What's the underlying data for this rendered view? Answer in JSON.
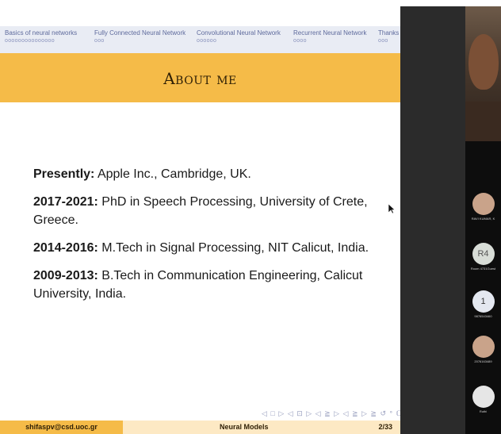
{
  "slide": {
    "nav_sections": [
      {
        "label": "Basics of neural networks",
        "dots": "ooooooooooooooo"
      },
      {
        "label": "Fully Connected Neural Network",
        "dots": "ooo"
      },
      {
        "label": "Convolutional Neural Network",
        "dots": "oooooo"
      },
      {
        "label": "Recurrent Neural Network",
        "dots": "oooo"
      },
      {
        "label": "Thanks",
        "dots": "ooo"
      }
    ],
    "title": "About me",
    "entries": [
      {
        "label": "Presently:",
        "text": " Apple Inc., Cambridge, UK."
      },
      {
        "label": "2017-2021:",
        "text": " PhD in Speech Processing, University of Crete, Greece."
      },
      {
        "label": "2014-2016:",
        "text": " M.Tech in Signal Processing, NIT Calicut, India."
      },
      {
        "label": "2009-2013:",
        "text": " B.Tech in Communication Engineering, Calicut University, India."
      }
    ],
    "nav_symbols": "◁ □ ▷ ◁ ⊡ ▷ ◁ ≧ ▷ ◁ ≧ ▷   ≧   ↺ ᐤ ℂ",
    "footer": {
      "email": "shifaspv@csd.uoc.gr",
      "title": "Neural Models",
      "page": "2/33"
    }
  },
  "participants": [
    {
      "name": "RAVI KUMAR, K",
      "avatar_type": "photo",
      "avatar_text": ""
    },
    {
      "name": "Room 4731Guest",
      "avatar_type": "initials",
      "avatar_text": "R4"
    },
    {
      "name": "9876543460",
      "avatar_type": "initials",
      "avatar_text": "1"
    },
    {
      "name": "2076163489",
      "avatar_type": "photo",
      "avatar_text": ""
    },
    {
      "name": "Ruthi",
      "avatar_type": "initials",
      "avatar_text": ""
    }
  ],
  "colors": {
    "accent": "#f5bb48",
    "nav_bg": "#e9ecf4",
    "nav_text": "#5e6a9c",
    "panel_bg": "#0d0d0d"
  }
}
